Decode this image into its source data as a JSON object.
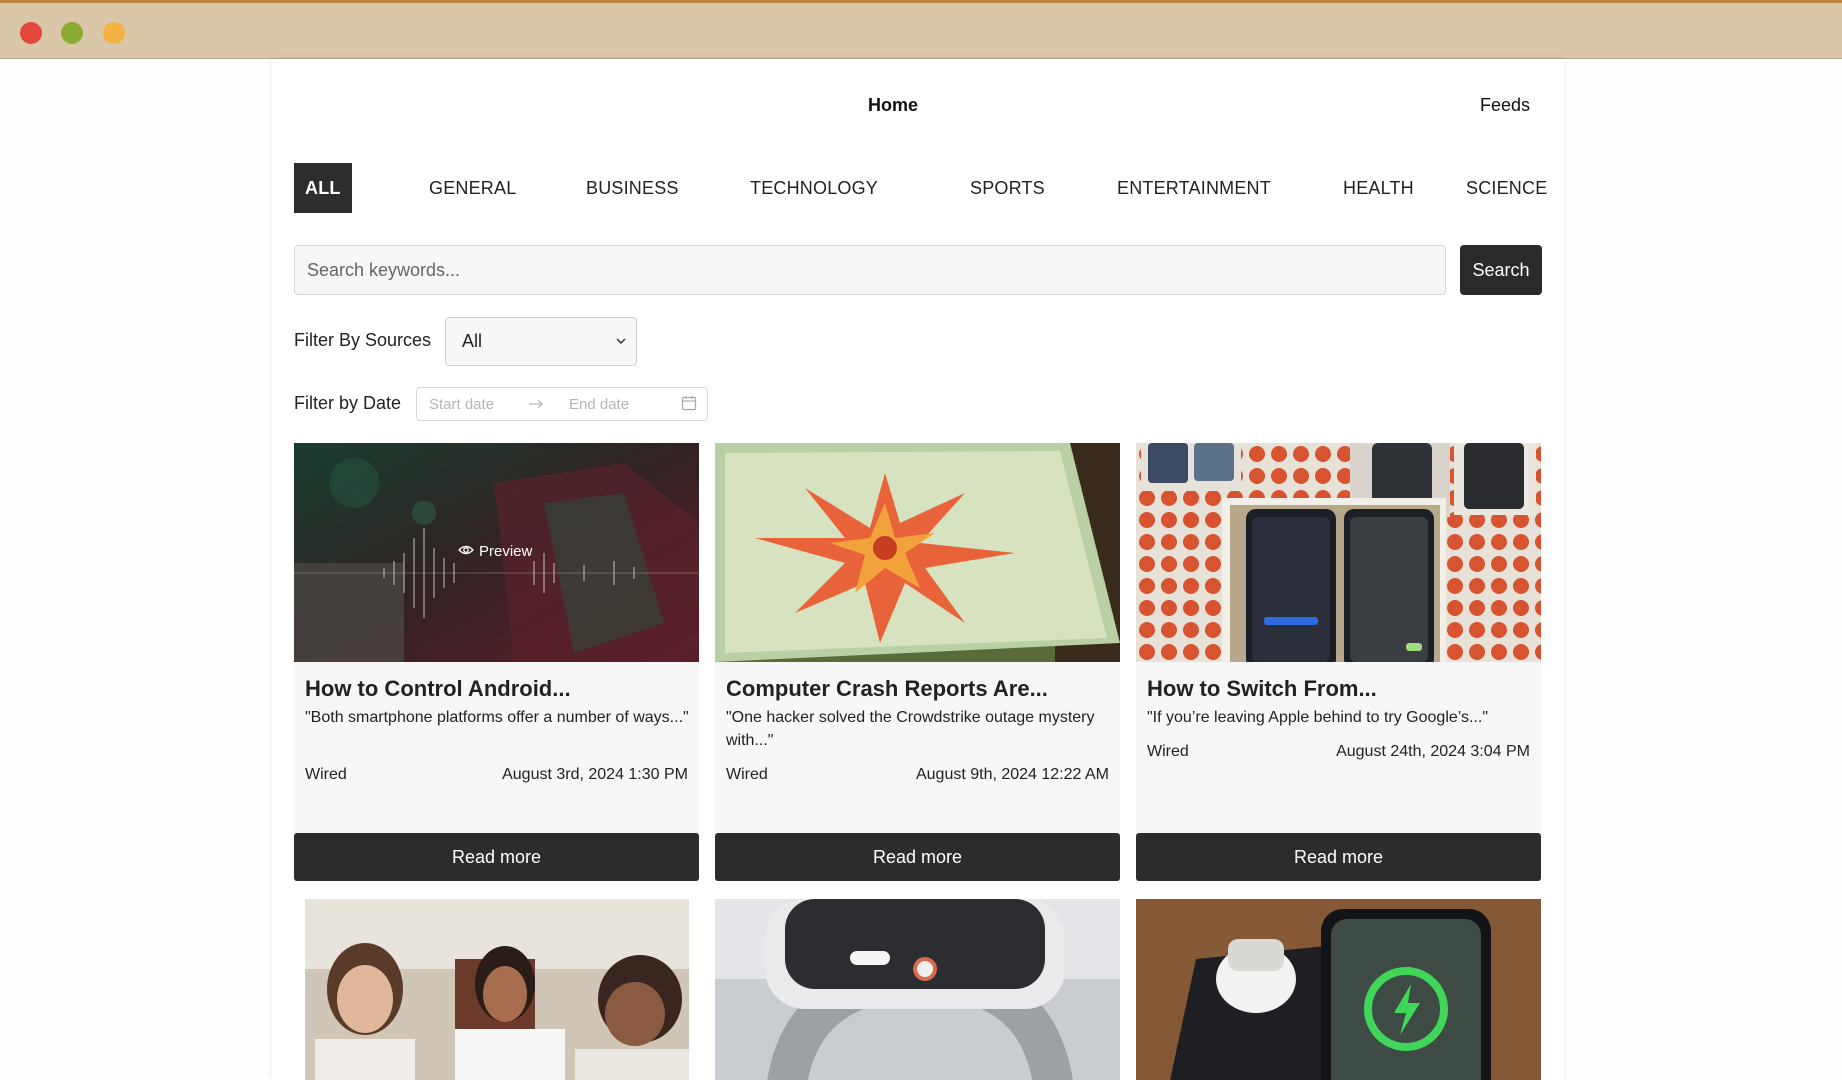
{
  "nav": {
    "home": "Home",
    "feeds": "Feeds"
  },
  "categories": [
    "ALL",
    "GENERAL",
    "BUSINESS",
    "TECHNOLOGY",
    "SPORTS",
    "ENTERTAINMENT",
    "HEALTH",
    "SCIENCE"
  ],
  "search": {
    "placeholder": "Search keywords...",
    "button": "Search"
  },
  "filters": {
    "sources_label": "Filter By Sources",
    "sources_value": "All",
    "date_label": "Filter by Date",
    "start_placeholder": "Start date",
    "end_placeholder": "End date"
  },
  "cards": [
    {
      "title": "How to Control Android...",
      "desc": "\"Both smartphone platforms offer a number of ways...\"",
      "source": "Wired",
      "date": "August 3rd, 2024 1:30 PM",
      "read": "Read more",
      "preview": "Preview"
    },
    {
      "title": "Computer Crash Reports Are...",
      "desc": "\"One hacker solved the Crowdstrike outage mystery with...\"",
      "source": "Wired",
      "date": "August 9th, 2024 12:22 AM",
      "read": "Read more"
    },
    {
      "title": "How to Switch From...",
      "desc": "\"If you’re leaving Apple behind to try Google’s...\"",
      "source": "Wired",
      "date": "August 24th, 2024 3:04 PM",
      "read": "Read more"
    }
  ],
  "colors": {
    "titlebar": "#d9c7a8",
    "dark": "#2c2c2c",
    "card_bg": "#f7f7f7"
  }
}
